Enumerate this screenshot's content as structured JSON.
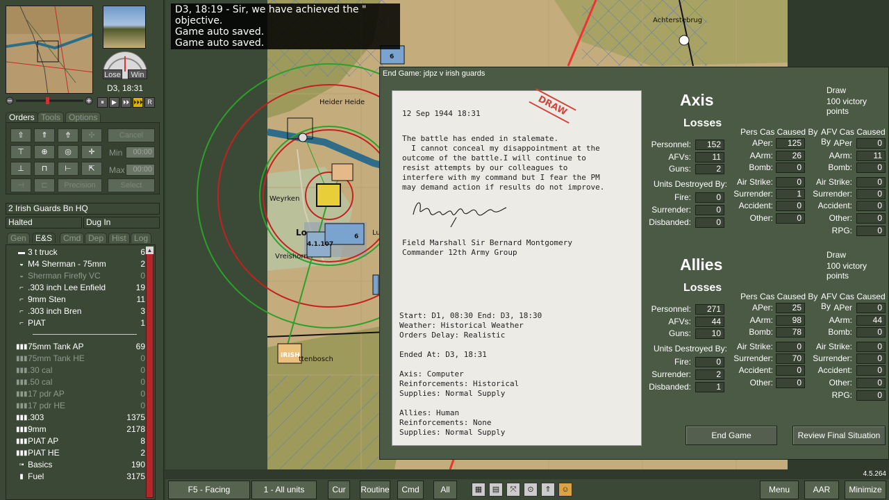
{
  "left_panel": {
    "gauge": {
      "lose": "Lose",
      "win": "Win"
    },
    "time": "D3, 18:31",
    "playback": [
      "⏸",
      "▶",
      "⏵⏵",
      "⏵⏵⏵",
      "R"
    ],
    "tabs": [
      "Orders",
      "Tools",
      "Options"
    ],
    "orders": {
      "cancel_label": "Cancel",
      "min_label": "Min",
      "max_label": "Max",
      "min_value": "00:00",
      "max_value": "00:00",
      "precision_label": "Precision",
      "select_label": "Select"
    },
    "unit_name": "2 Irish Guards Bn HQ",
    "status_1": "Halted",
    "status_2": "Dug In",
    "sub_tabs": [
      "Gen",
      "E&S",
      "Cmd",
      "Dep",
      "Hist",
      "Log"
    ],
    "equipment": [
      {
        "icon": "truck-icon",
        "glyph": "▬",
        "name": "3 t truck",
        "count": "6",
        "dim": false
      },
      {
        "icon": "tank-icon",
        "glyph": "◒",
        "name": "M4 Sherman - 75mm",
        "count": "2",
        "dim": false
      },
      {
        "icon": "tank-icon",
        "glyph": "◒",
        "name": "Sherman Firefly VC",
        "count": "0",
        "dim": true
      },
      {
        "icon": "rifle-icon",
        "glyph": "⌐",
        "name": ".303 inch Lee Enfield",
        "count": "19",
        "dim": false
      },
      {
        "icon": "smg-icon",
        "glyph": "⌐",
        "name": "9mm Sten",
        "count": "11",
        "dim": false
      },
      {
        "icon": "mg-icon",
        "glyph": "⌐",
        "name": ".303 inch Bren",
        "count": "3",
        "dim": false
      },
      {
        "icon": "at-weapon-icon",
        "glyph": "⌐",
        "name": "PIAT",
        "count": "1",
        "dim": false
      },
      {
        "icon": "ammo-icon",
        "glyph": "▮▮▮",
        "name": "75mm Tank AP",
        "count": "69",
        "dim": false
      },
      {
        "icon": "ammo-icon",
        "glyph": "▮▮▮",
        "name": "75mm Tank HE",
        "count": "0",
        "dim": true
      },
      {
        "icon": "ammo-icon",
        "glyph": "▮▮▮",
        "name": ".30 cal",
        "count": "0",
        "dim": true
      },
      {
        "icon": "ammo-icon",
        "glyph": "▮▮▮",
        "name": ".50 cal",
        "count": "0",
        "dim": true
      },
      {
        "icon": "ammo-icon",
        "glyph": "▮▮▮",
        "name": "17 pdr AP",
        "count": "0",
        "dim": true
      },
      {
        "icon": "ammo-icon",
        "glyph": "▮▮▮",
        "name": "17 pdr HE",
        "count": "0",
        "dim": true
      },
      {
        "icon": "ammo-icon",
        "glyph": "▮▮▮",
        "name": ".303",
        "count": "1375",
        "dim": false
      },
      {
        "icon": "ammo-icon",
        "glyph": "▮▮▮",
        "name": "9mm",
        "count": "2178",
        "dim": false
      },
      {
        "icon": "ammo-icon",
        "glyph": "▮▮▮",
        "name": "PIAT AP",
        "count": "8",
        "dim": false
      },
      {
        "icon": "ammo-icon",
        "glyph": "▮▮▮",
        "name": "PIAT HE",
        "count": "2",
        "dim": false
      },
      {
        "icon": "basics-icon",
        "glyph": "▫▪",
        "name": "Basics",
        "count": "190",
        "dim": false
      },
      {
        "icon": "fuel-icon",
        "glyph": "▮",
        "name": "Fuel",
        "count": "3175",
        "dim": false
      }
    ]
  },
  "map": {
    "messages": [
      "D3, 18:19 - Sir, we have achieved the \" objective.",
      "Game auto saved.",
      "Game auto saved."
    ],
    "place_names": [
      "Achterstebrug",
      "Heider Heide",
      "Weyrken",
      "Vreishorn",
      "Lo",
      "Lu",
      "ttenbosch"
    ],
    "unit_counters": [
      {
        "label": "6"
      },
      {
        "label": "4.1.107"
      },
      {
        "label": "IRISH"
      },
      {
        "label": "6"
      }
    ]
  },
  "dialog": {
    "title": "End Game: jdpz v irish guards",
    "letter": {
      "date": "12 Sep 1944 18:31",
      "stamp": "DRAW",
      "body": [
        "The battle has ended in stalemate.",
        "  I cannot conceal my disappointment at the",
        "outcome of the battle.I will continue to",
        "resist attempts by our colleagues to",
        "interfere with my command but I fear the PM",
        "may demand action if results do not improve."
      ],
      "signatory": "Field Marshall Sir Bernard Montgomery",
      "signatory_title": "Commander 12th Army Group",
      "details": [
        "Start: D1, 08:30 End: D3, 18:30",
        "Weather: Historical Weather",
        "Orders Delay: Realistic",
        "",
        "Ended At: D3, 18:31",
        "",
        "Axis: Computer",
        "Reinforcements: Historical",
        "Supplies: Normal Supply",
        "",
        "Allies: Human",
        "Reinforcements: None",
        "Supplies: Normal Supply"
      ]
    },
    "col_headers": {
      "pers": "Pers Cas Caused By",
      "afv": "AFV Cas Caused By"
    },
    "units_destroyed_label": "Units Destroyed By:",
    "losses_label": "Losses",
    "axis": {
      "name": "Axis",
      "result": "Draw",
      "points": "100 victory points",
      "personnel": "152",
      "afvs": "11",
      "guns": "2",
      "fire": "0",
      "surrender": "0",
      "disbanded": "0",
      "pers": {
        "aper": "125",
        "aarm": "26",
        "bomb": "0",
        "airstrike": "0",
        "surrender": "1",
        "accident": "0",
        "other": "0"
      },
      "afv": {
        "aper": "0",
        "aarm": "11",
        "bomb": "0",
        "airstrike": "0",
        "surrender": "0",
        "accident": "0",
        "other": "0",
        "rpg": "0"
      }
    },
    "allies": {
      "name": "Allies",
      "result": "Draw",
      "points": "100 victory points",
      "personnel": "271",
      "afvs": "44",
      "guns": "10",
      "fire": "0",
      "surrender": "2",
      "disbanded": "1",
      "pers": {
        "aper": "25",
        "aarm": "98",
        "bomb": "78",
        "airstrike": "0",
        "surrender": "70",
        "accident": "0",
        "other": "0"
      },
      "afv": {
        "aper": "0",
        "aarm": "44",
        "bomb": "0",
        "airstrike": "0",
        "surrender": "0",
        "accident": "0",
        "other": "0",
        "rpg": "0"
      }
    },
    "labels": {
      "personnel": "Personnel:",
      "afvs": "AFVs:",
      "guns": "Guns:",
      "fire": "Fire:",
      "surrender": "Surrender:",
      "disbanded": "Disbanded:",
      "aper": "APer:",
      "aarm": "AArm:",
      "bomb": "Bomb:",
      "airstrike": "Air Strike:",
      "accident": "Accident:",
      "other": "Other:",
      "rpg": "RPG:",
      "aper_noc": "APer"
    },
    "buttons": {
      "end_game": "End Game",
      "review": "Review Final Situation"
    }
  },
  "bottom_bar": {
    "facing": "F5 - Facing",
    "units": "1 - All units",
    "cur": "Cur",
    "routine": "Routine",
    "cmd": "Cmd",
    "all": "All",
    "menu": "Menu",
    "aar": "AAR",
    "minimize": "Minimize"
  },
  "version": "4.5.264"
}
